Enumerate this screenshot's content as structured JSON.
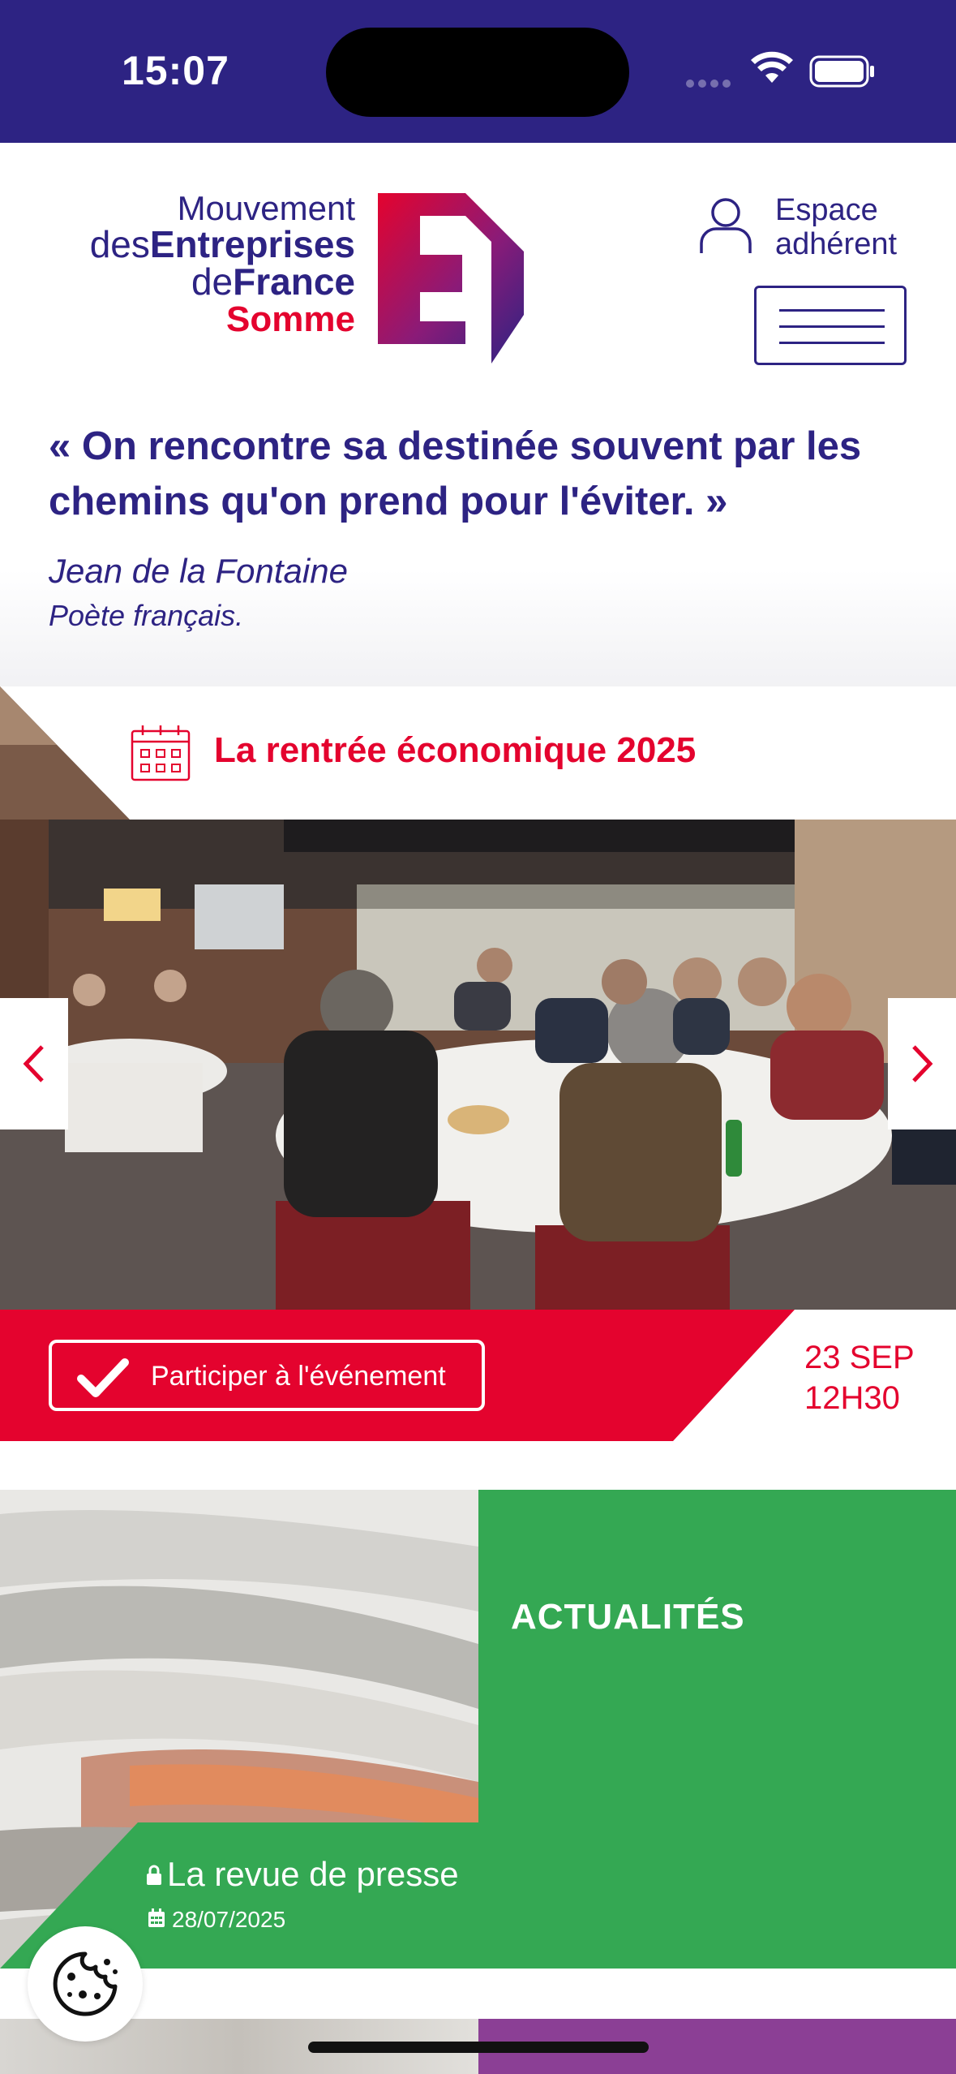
{
  "status_bar": {
    "time": "15:07",
    "icons": [
      "signal-dots-icon",
      "wifi-icon",
      "battery-icon"
    ]
  },
  "header": {
    "logo": {
      "line1": "Mouvement",
      "line2_light": "des",
      "line2_bold": "Entreprises",
      "line3_light": "de",
      "line3_bold": "France",
      "line4": "Somme"
    },
    "account": {
      "line1": "Espace",
      "line2": "adhérent",
      "icon": "user-icon"
    },
    "menu_icon": "hamburger-menu-icon"
  },
  "quote": {
    "text": "« On rencontre sa destinée souvent par les chemins qu'on prend pour l'éviter. »",
    "author": "Jean de la Fontaine",
    "role": "Poète français."
  },
  "event": {
    "icon": "calendar-icon",
    "title": "La rentrée économique 2025",
    "participate_label": "Participer à l'événement",
    "date_line1": "23 SEP",
    "date_line2": "12H30",
    "prev_icon": "chevron-left-icon",
    "next_icon": "chevron-right-icon"
  },
  "news": {
    "heading": "ACTUALITÉS",
    "item_title": "La revue de presse",
    "item_date": "28/07/2025",
    "lock_icon": "lock-icon",
    "date_icon": "calendar-mini-icon"
  },
  "cookie": {
    "icon": "cookie-icon"
  },
  "colors": {
    "brand_blue": "#2d2383",
    "brand_red": "#e4032e",
    "news_green": "#34a853",
    "next_purple": "#8b3f95"
  }
}
